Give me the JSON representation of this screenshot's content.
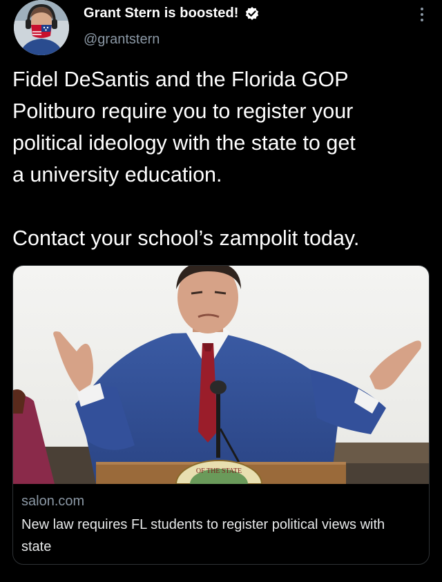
{
  "author": {
    "display_name": "Grant Stern is boosted!",
    "handle": "@grantstern",
    "verified": true,
    "avatar_icon": "profile-avatar"
  },
  "tweet": {
    "text": "Fidel DeSantis and the Florida GOP\nPolitburo require you to register your\npolitical ideology with the state to get\na university education.\n\nContact your school’s zampolit today."
  },
  "link_card": {
    "domain": "salon.com",
    "title": "New law requires FL students to register political views with state",
    "image_seal_text": "OF THE STATE"
  },
  "colors": {
    "background": "#000000",
    "text_primary": "#ffffff",
    "text_secondary": "#8b98a5",
    "verified_badge": "#ffffff",
    "card_border": "#2f3336"
  },
  "icons": {
    "verified": "verified-badge-icon",
    "more": "more-options-icon"
  }
}
